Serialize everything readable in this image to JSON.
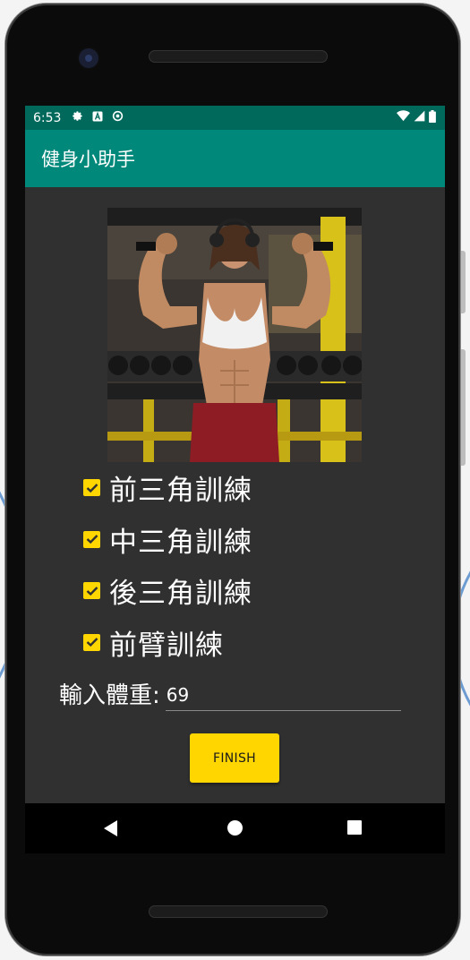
{
  "status_bar": {
    "time": "6:53",
    "left_icons": [
      "gear-icon",
      "a-notification-icon",
      "sync-icon"
    ],
    "right_icons": [
      "wifi-icon",
      "signal-icon",
      "battery-icon"
    ],
    "color": "#00695c"
  },
  "app_bar": {
    "title": "健身小助手",
    "color": "#00897b"
  },
  "hero_image": {
    "subject": "fitness-woman-flexing-photo"
  },
  "checklist": {
    "items": [
      {
        "label": "前三角訓練",
        "checked": true
      },
      {
        "label": "中三角訓練",
        "checked": true
      },
      {
        "label": "後三角訓練",
        "checked": true
      },
      {
        "label": "前臂訓練",
        "checked": true
      }
    ],
    "accent": "#ffd600"
  },
  "weight": {
    "label": "輸入體重:",
    "value": "69"
  },
  "finish_button": {
    "label": "FINISH",
    "color": "#ffd600"
  },
  "navigation": {
    "icons": [
      "back-icon",
      "home-icon",
      "recents-icon"
    ]
  },
  "theme": {
    "background": "#303030",
    "text": "#ffffff"
  }
}
